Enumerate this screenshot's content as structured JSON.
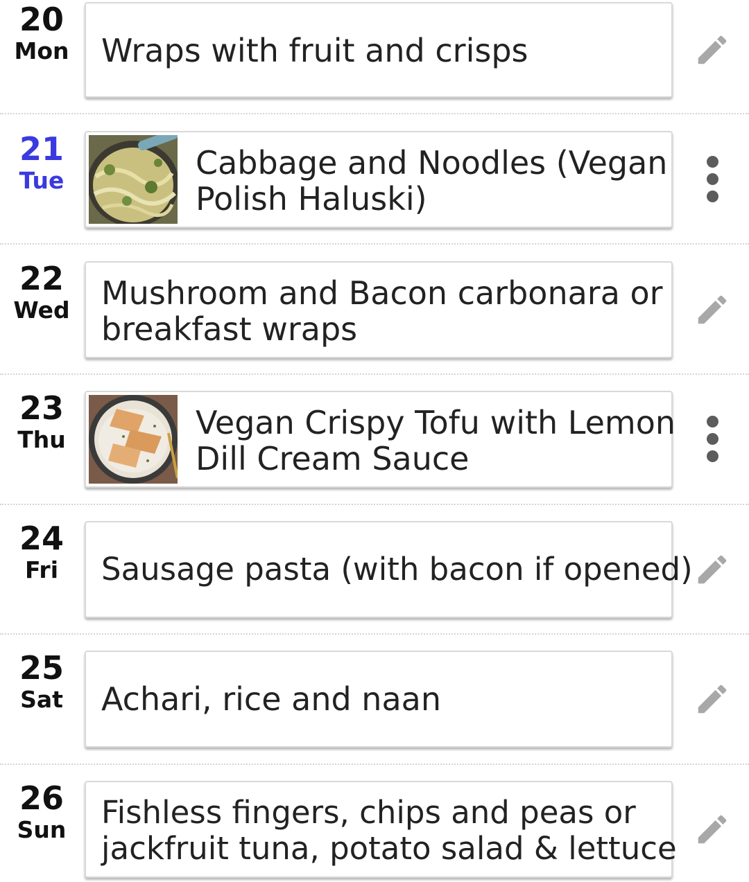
{
  "days": [
    {
      "num": "20",
      "dow": "Mon",
      "title_lines": [
        "Wraps with fruit and crisps"
      ],
      "action": "pencil-icon"
    },
    {
      "num": "21",
      "dow": "Tue",
      "title_lines": [
        "Cabbage and Noodles (Vegan",
        "Polish Haluski)"
      ],
      "action": "more-vert-icon",
      "today": true,
      "today_color": "#3a3ae0"
    },
    {
      "num": "22",
      "dow": "Wed",
      "title_lines": [
        "Mushroom and Bacon carbonara or",
        "breakfast wraps"
      ],
      "action": "pencil-icon"
    },
    {
      "num": "23",
      "dow": "Thu",
      "title_lines": [
        "Vegan Crispy Tofu with Lemon",
        "Dill Cream Sauce"
      ],
      "action": "more-vert-icon"
    },
    {
      "num": "24",
      "dow": "Fri",
      "title_lines": [
        "Sausage pasta (with bacon if opened)"
      ],
      "action": "pencil-icon"
    },
    {
      "num": "25",
      "dow": "Sat",
      "title_lines": [
        "Achari, rice and naan"
      ],
      "action": "pencil-icon"
    },
    {
      "num": "26",
      "dow": "Sun",
      "title_lines": [
        "Fishless fingers, chips and peas or",
        "jackfruit tuna, potato salad & lettuce"
      ],
      "action": "pencil-icon"
    }
  ]
}
